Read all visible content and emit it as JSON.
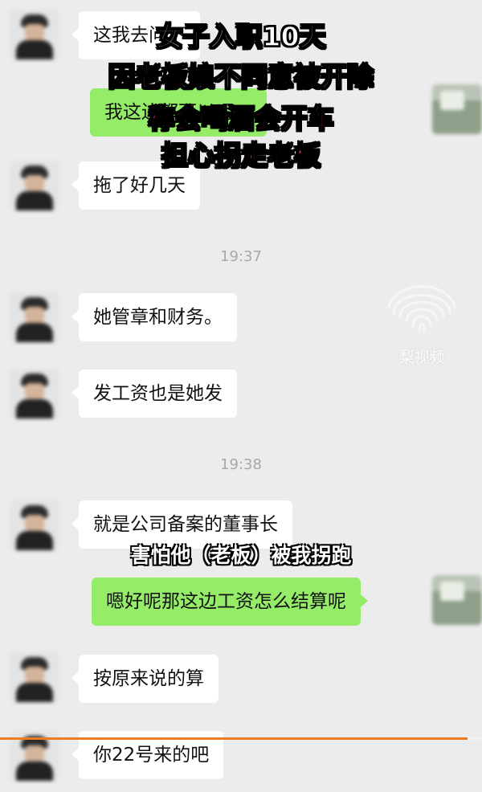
{
  "captions": {
    "line1": "女子入职10天",
    "line2": "因老板娘不同意被开除",
    "line3": "称会喝酒会开车",
    "line4": "担心拐走老板"
  },
  "subtitle": "害怕他（老板）被我拐跑",
  "watermark": "梨视频",
  "chat": {
    "msg1": "这我去问下",
    "msg2": "我这边都可以呢～",
    "msg3": "拖了好几天",
    "time1": "19:37",
    "msg4": "她管章和财务。",
    "msg5": "发工资也是她发",
    "time2": "19:38",
    "msg6": "就是公司备案的董事长",
    "msg7": "嗯好呢那这边工资怎么结算呢",
    "msg8": "按原来说的算",
    "msg9": "你22号来的吧"
  },
  "video_progress": 0.97,
  "colors": {
    "self_bubble": "#95ec69",
    "other_bubble": "#ffffff",
    "caption_red": "#f23434",
    "progress": "#f07a1e"
  }
}
